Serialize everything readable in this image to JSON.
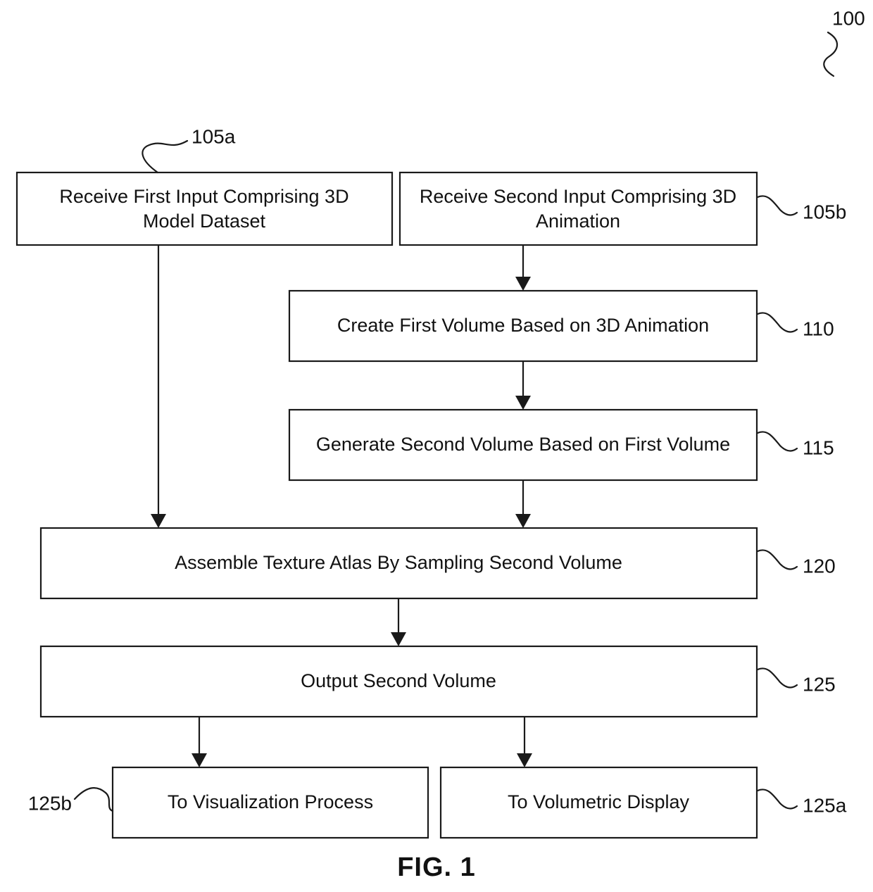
{
  "figure": {
    "caption": "FIG. 1",
    "system_ref": "100"
  },
  "boxes": [
    {
      "id": "105a",
      "ref": "105a",
      "ref_side": "top-left-leader",
      "lines": [
        "Receive First Input Comprising 3D",
        "Model Dataset"
      ],
      "text": "Receive First Input Comprising 3D Model Dataset"
    },
    {
      "id": "105b",
      "ref": "105b",
      "ref_side": "right",
      "lines": [
        "Receive Second Input Comprising 3D",
        "Animation"
      ],
      "text": "Receive Second Input Comprising 3D Animation"
    },
    {
      "id": "110",
      "ref": "110",
      "ref_side": "right",
      "lines": [
        "Create First Volume Based on 3D Animation"
      ],
      "text": "Create First Volume Based on 3D Animation"
    },
    {
      "id": "115",
      "ref": "115",
      "ref_side": "right",
      "lines": [
        "Generate Second Volume Based on First Volume"
      ],
      "text": "Generate Second Volume Based on First Volume"
    },
    {
      "id": "120",
      "ref": "120",
      "ref_side": "right",
      "lines": [
        "Assemble Texture Atlas By Sampling Second Volume"
      ],
      "text": "Assemble Texture Atlas By Sampling Second Volume"
    },
    {
      "id": "125",
      "ref": "125",
      "ref_side": "right",
      "lines": [
        "Output Second Volume"
      ],
      "text": "Output Second Volume"
    },
    {
      "id": "125b",
      "ref": "125b",
      "ref_side": "left",
      "lines": [
        "To Visualization Process"
      ],
      "text": "To Visualization Process"
    },
    {
      "id": "125a",
      "ref": "125a",
      "ref_side": "right",
      "lines": [
        "To Volumetric Display"
      ],
      "text": "To Volumetric Display"
    }
  ],
  "flow": {
    "edges": [
      {
        "from": "105a",
        "to": "120"
      },
      {
        "from": "105b",
        "to": "110"
      },
      {
        "from": "110",
        "to": "115"
      },
      {
        "from": "115",
        "to": "120"
      },
      {
        "from": "120",
        "to": "125"
      },
      {
        "from": "125",
        "to": "125b"
      },
      {
        "from": "125",
        "to": "125a"
      }
    ]
  },
  "colors": {
    "ink": "#1a1a1a",
    "paper": "#ffffff"
  }
}
